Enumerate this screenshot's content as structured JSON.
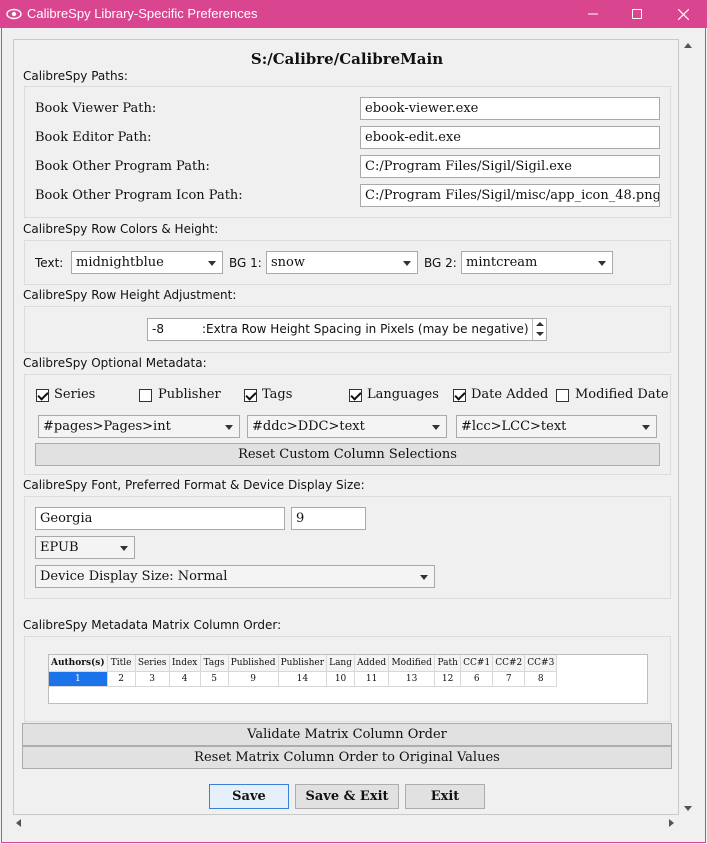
{
  "window": {
    "title": "CalibreSpy Library-Specific Preferences",
    "min_glyph": "—",
    "max_glyph": "☐",
    "close_glyph": "✕"
  },
  "library_path": "S:/Calibre/CalibreMain",
  "paths": {
    "section": "CalibreSpy Paths:",
    "viewer_label": "Book Viewer Path:",
    "viewer_value": "ebook-viewer.exe",
    "editor_label": "Book Editor Path:",
    "editor_value": "ebook-edit.exe",
    "other_label": "Book Other Program Path:",
    "other_value": "C:/Program Files/Sigil/Sigil.exe",
    "other_icon_label": "Book Other Program Icon Path:",
    "other_icon_value": "C:/Program Files/Sigil/misc/app_icon_48.png"
  },
  "row_colors": {
    "section": "CalibreSpy Row Colors & Height:",
    "text_label": "Text:",
    "text_value": "midnightblue",
    "bg1_label": "BG 1:",
    "bg1_value": "snow",
    "bg2_label": "BG 2:",
    "bg2_value": "mintcream"
  },
  "row_height": {
    "section": "CalibreSpy Row Height Adjustment:",
    "value": "-8",
    "suffix": ":Extra Row Height Spacing in Pixels (may be negative)"
  },
  "optional_metadata": {
    "section": "CalibreSpy Optional Metadata:",
    "checks": [
      {
        "label": "Series",
        "checked": true
      },
      {
        "label": "Publisher",
        "checked": false
      },
      {
        "label": "Tags",
        "checked": true
      },
      {
        "label": "Languages",
        "checked": true
      },
      {
        "label": "Date Added",
        "checked": true
      },
      {
        "label": "Modified Date",
        "checked": false
      }
    ],
    "custom_col_1": "#pages>Pages>int",
    "custom_col_2": "#ddc>DDC>text",
    "custom_col_3": "#lcc>LCC>text",
    "reset_button": "Reset Custom Column Selections"
  },
  "font": {
    "section": "CalibreSpy Font, Preferred Format & Device Display Size:",
    "font_name": "Georgia",
    "font_size": "9",
    "format": "EPUB",
    "device_size": "Device Display Size: Normal"
  },
  "matrix": {
    "section": "CalibreSpy Metadata Matrix Column Order:",
    "headers": [
      "Authors(s)",
      "Title",
      "Series",
      "Index",
      "Tags",
      "Published",
      "Publisher",
      "Lang",
      "Added",
      "Modified",
      "Path",
      "CC#1",
      "CC#2",
      "CC#3"
    ],
    "values": [
      "1",
      "2",
      "3",
      "4",
      "5",
      "9",
      "14",
      "10",
      "11",
      "13",
      "12",
      "6",
      "7",
      "8"
    ],
    "validate_button": "Validate Matrix Column Order",
    "reset_button": "Reset Matrix Column Order to Original Values"
  },
  "buttons": {
    "save": "Save",
    "save_exit": "Save & Exit",
    "exit": "Exit"
  },
  "colors": {
    "titlebar": "#d9468f",
    "selection": "#1a73e8"
  }
}
